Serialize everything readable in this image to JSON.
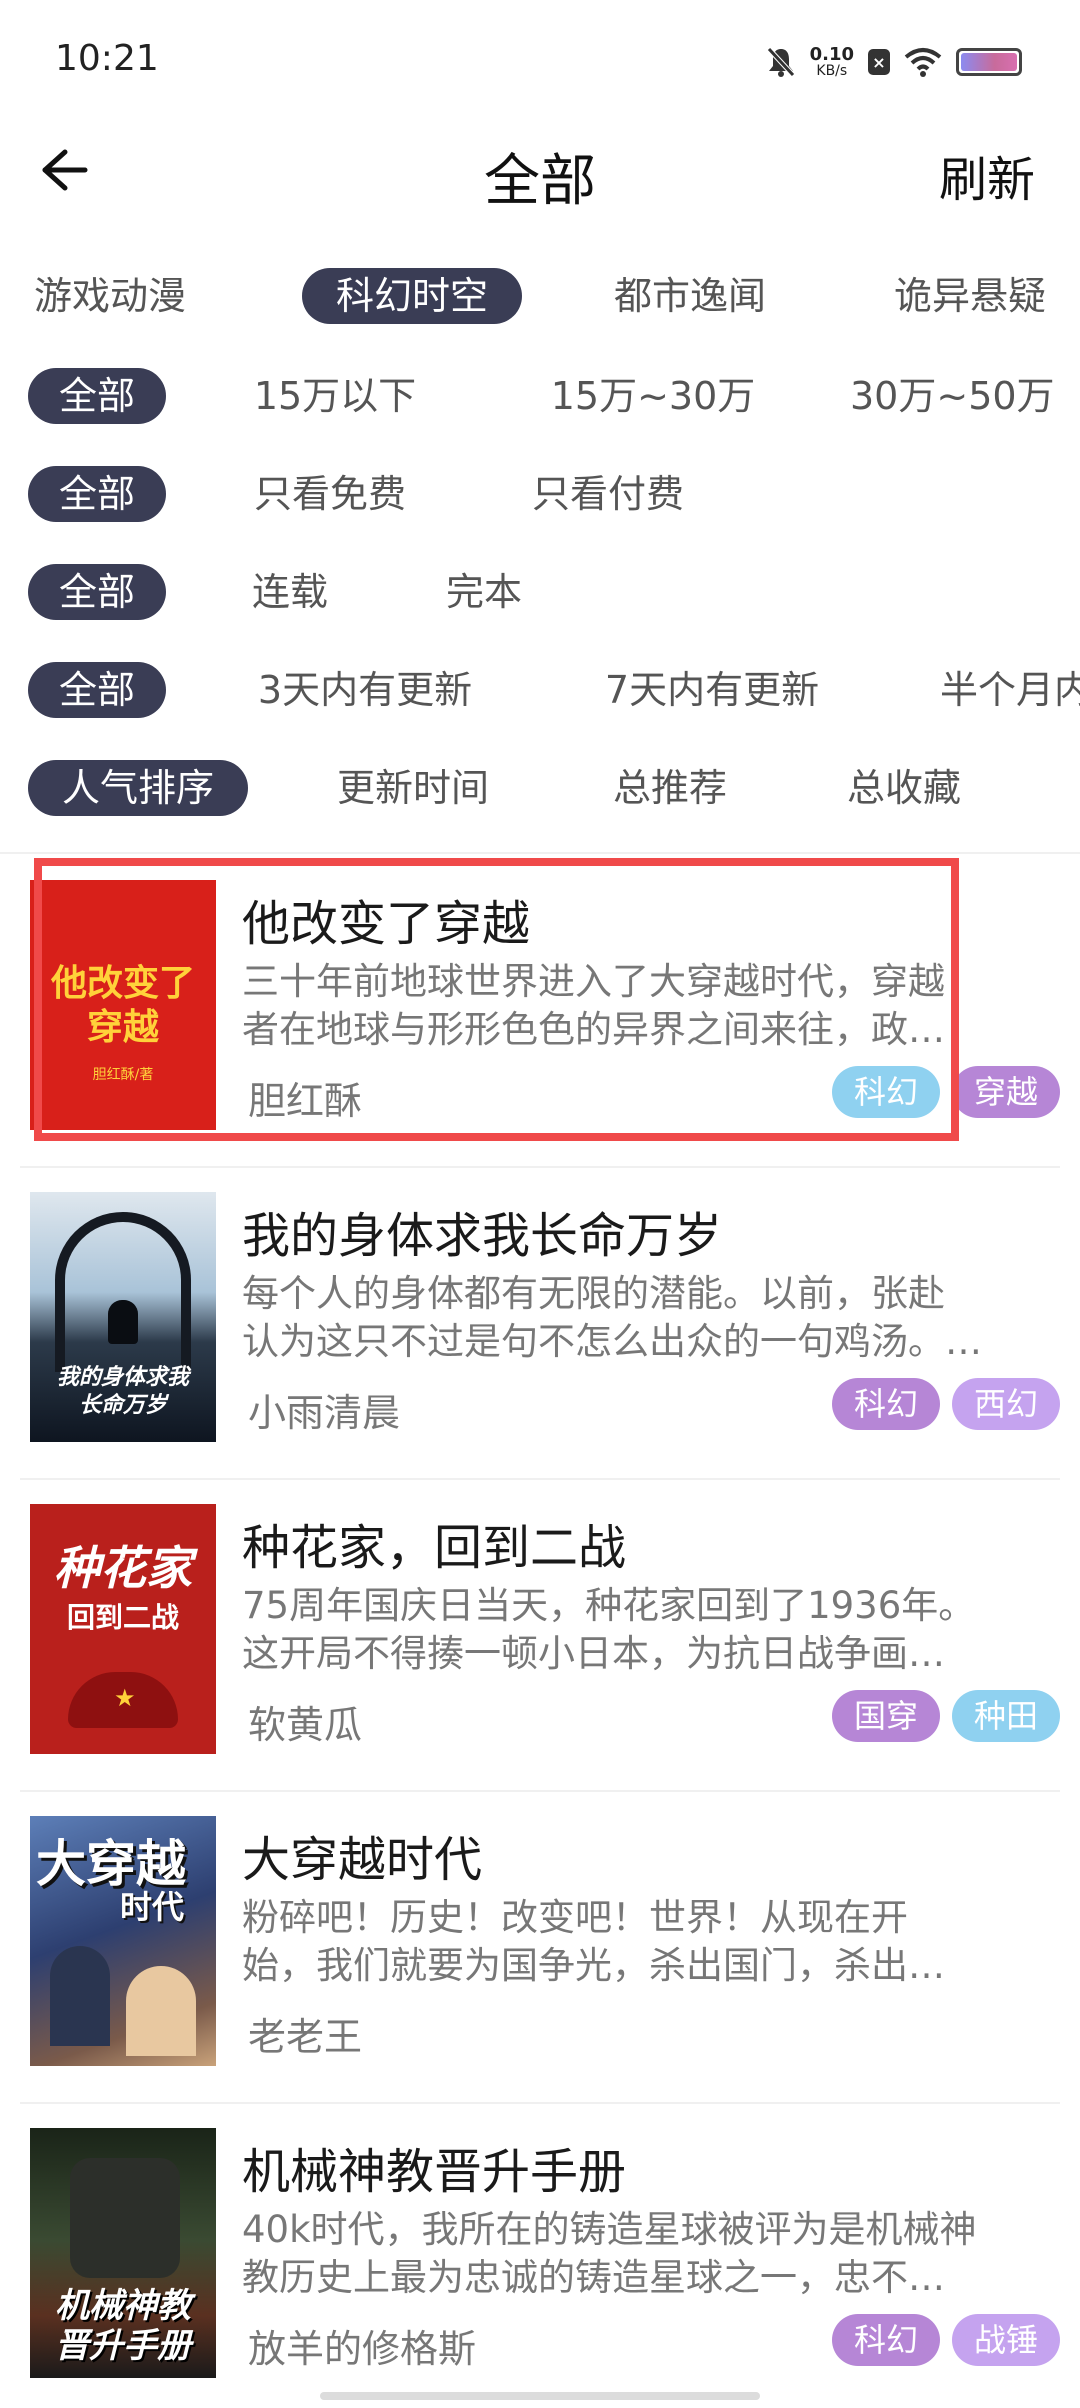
{
  "status": {
    "time": "10:21",
    "speed_value": "0.10",
    "speed_unit": "KB/s"
  },
  "header": {
    "title": "全部",
    "refresh": "刷新"
  },
  "filters": {
    "categories": [
      "游戏动漫",
      "科幻时空",
      "都市逸闻",
      "诡异悬疑"
    ],
    "word_count": [
      "全部",
      "15万以下",
      "15万~30万",
      "30万~50万"
    ],
    "price": [
      "全部",
      "只看免费",
      "只看付费"
    ],
    "status": [
      "全部",
      "连载",
      "完本"
    ],
    "update": [
      "全部",
      "3天内有更新",
      "7天内有更新",
      "半个月内"
    ],
    "sort": [
      "人气排序",
      "更新时间",
      "总推荐",
      "总收藏"
    ]
  },
  "books": [
    {
      "title": "他改变了穿越",
      "desc_line1": "三十年前地球世界进入了大穿越时代，穿越",
      "desc_line2": "者在地球与形形色色的异界之间来往，政…",
      "author": "胆红酥",
      "tags": [
        "科幻",
        "穿越"
      ],
      "cover_text1": "他改变了",
      "cover_text2": "穿越",
      "cover_author": "胆红酥/著"
    },
    {
      "title": "我的身体求我长命万岁",
      "desc_line1": "每个人的身体都有无限的潜能。以前，张赴",
      "desc_line2": "认为这只不过是句不怎么出众的一句鸡汤。…",
      "author": "小雨清晨",
      "tags": [
        "科幻",
        "西幻"
      ],
      "cover_text1": "我的身体求我",
      "cover_text2": "长命万岁"
    },
    {
      "title": "种花家，回到二战",
      "desc_line1": "75周年国庆日当天，种花家回到了1936年。",
      "desc_line2": "这开局不得揍一顿小日本，为抗日战争画…",
      "author": "软黄瓜",
      "tags": [
        "国穿",
        "种田"
      ],
      "cover_text1": "种花家",
      "cover_text2": "回到二战"
    },
    {
      "title": "大穿越时代",
      "desc_line1": "粉碎吧！历史！改变吧！世界！从现在开",
      "desc_line2": "始，我们就要为国争光，杀出国门，杀出…",
      "author": "老老王",
      "tags": [],
      "cover_text1": "大穿越",
      "cover_text2": "时代"
    },
    {
      "title": "机械神教晋升手册",
      "desc_line1": "40k时代，我所在的铸造星球被评为是机械神",
      "desc_line2": "教历史上最为忠诚的铸造星球之一，忠不…",
      "author": "放羊的修格斯",
      "tags": [
        "科幻",
        "战锤"
      ],
      "cover_text1": "机械神教",
      "cover_text2": "晋升手册"
    }
  ]
}
